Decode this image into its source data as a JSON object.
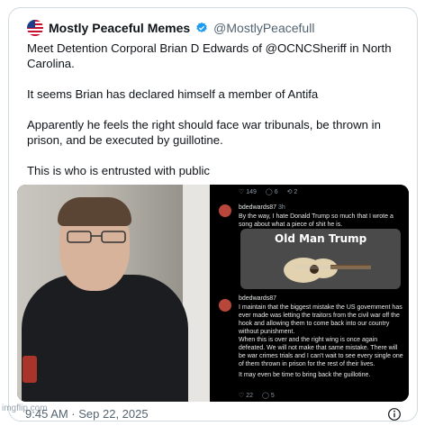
{
  "tweet": {
    "display_name": "Mostly Peaceful Memes",
    "handle": "@MostlyPeacefull",
    "paragraphs": [
      "Meet Detention Corporal Brian D Edwards of @OCNCSheriff in North Carolina.",
      "It seems Brian has declared himself a member of Antifa",
      "Apparently he feels the right should face war tribunals, be thrown in prison, and be executed by guillotine.",
      "This is who is entrusted with public"
    ],
    "timestamp": "9:45 AM · Sep 22, 2025"
  },
  "screenshot_top": {
    "stats": [
      "149",
      "6",
      "2"
    ],
    "reply_name": "bdedwards87",
    "reply_time": "3h",
    "reply_text": "By the way, I hate Donald Trump so much that I wrote a song about what a piece of shit he is.",
    "song_title": "Old Man Trump"
  },
  "screenshot_bottom": {
    "reply_name": "bdedwards87",
    "lines": [
      "I maintain that the biggest mistake the US government has ever made was letting the traitors from the civil war off the hook and allowing them to come back into our country without punishment.",
      "When this is over and the right wing is once again defeated. We will not make that same mistake. There will be war crimes trials and I can't wait to see every single one of them thrown in prison for the rest of their lives.",
      "It may even be time to bring back the guillotine."
    ],
    "stats": [
      "22",
      "5"
    ]
  },
  "watermark": "imgflip.com",
  "colors": {
    "text": "#0f1419",
    "muted": "#536471",
    "verified": "#1d9bf0",
    "border": "#cfd9de"
  },
  "icons": [
    "verified-badge-icon",
    "info-icon",
    "heart-icon",
    "reply-icon",
    "repost-icon"
  ]
}
